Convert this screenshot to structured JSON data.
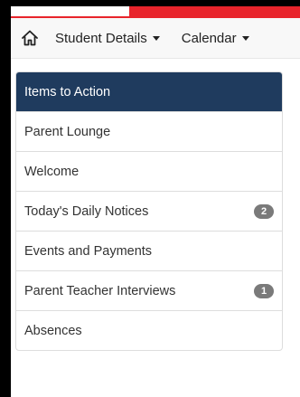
{
  "colors": {
    "accent_red": "#e8242b",
    "active_bg": "#1f3b5e",
    "badge_bg": "#7a7a7a"
  },
  "navbar": {
    "home_icon": "home-icon",
    "items": [
      {
        "label": "Student Details",
        "has_dropdown": true
      },
      {
        "label": "Calendar",
        "has_dropdown": true
      }
    ]
  },
  "menu": {
    "items": [
      {
        "label": "Items to Action",
        "active": true
      },
      {
        "label": "Parent Lounge"
      },
      {
        "label": "Welcome"
      },
      {
        "label": "Today's Daily Notices",
        "badge": "2"
      },
      {
        "label": "Events and Payments"
      },
      {
        "label": "Parent Teacher Interviews",
        "badge": "1"
      },
      {
        "label": "Absences"
      }
    ]
  }
}
